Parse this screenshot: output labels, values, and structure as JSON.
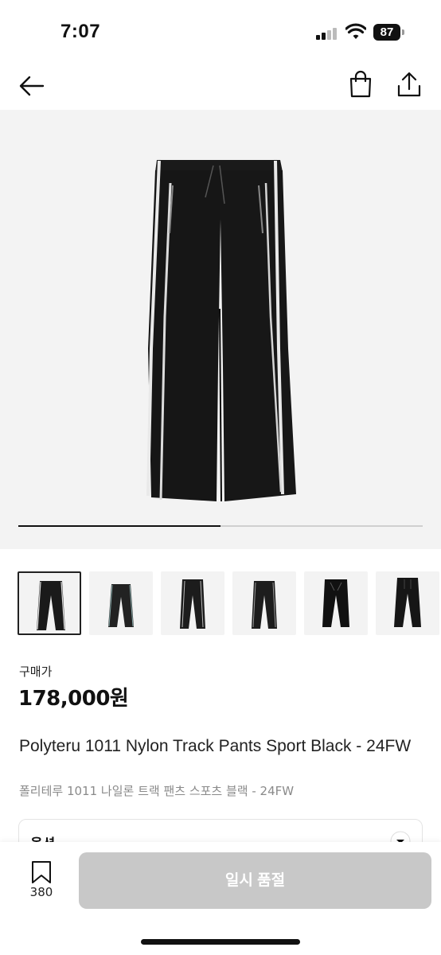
{
  "status_bar": {
    "time": "7:07",
    "battery": "87"
  },
  "nav": {
    "back_icon": "arrow-left-icon",
    "cart_icon": "shopping-bag-icon",
    "share_icon": "share-icon"
  },
  "gallery": {
    "progress": 0.5,
    "thumbnail_count": 6,
    "active_index": 0
  },
  "price": {
    "label": "구매가",
    "value": "178,000원"
  },
  "product": {
    "title": "Polyteru 1011 Nylon Track Pants Sport Black - 24FW",
    "subtitle": "폴리테루 1011 나일론 트랙 팬츠 스포츠 블랙 - 24FW"
  },
  "option": {
    "label": "옵션"
  },
  "bottom": {
    "bookmark_count": "380",
    "button_label": "일시 품절"
  },
  "colors": {
    "disabled_button": "#c8c8c8",
    "image_bg": "#f3f3f3",
    "subtext": "#8a8a8a"
  }
}
